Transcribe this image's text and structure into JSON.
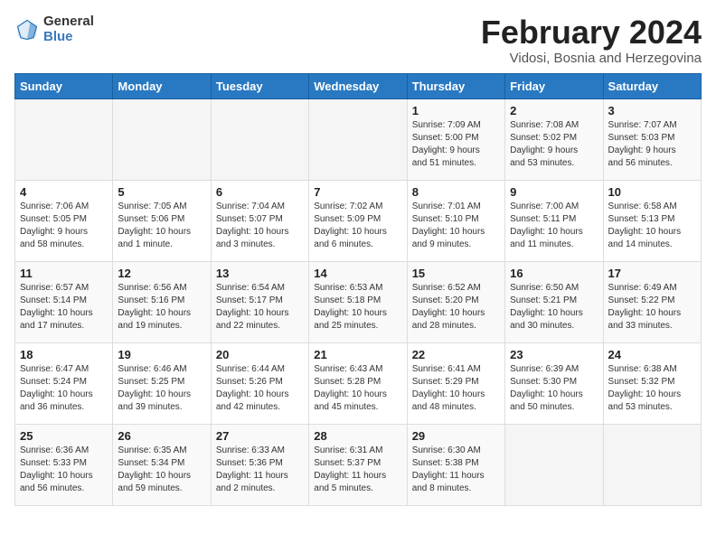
{
  "logo": {
    "general": "General",
    "blue": "Blue"
  },
  "title": "February 2024",
  "subtitle": "Vidosi, Bosnia and Herzegovina",
  "weekdays": [
    "Sunday",
    "Monday",
    "Tuesday",
    "Wednesday",
    "Thursday",
    "Friday",
    "Saturday"
  ],
  "weeks": [
    [
      {
        "day": "",
        "info": ""
      },
      {
        "day": "",
        "info": ""
      },
      {
        "day": "",
        "info": ""
      },
      {
        "day": "",
        "info": ""
      },
      {
        "day": "1",
        "info": "Sunrise: 7:09 AM\nSunset: 5:00 PM\nDaylight: 9 hours\nand 51 minutes."
      },
      {
        "day": "2",
        "info": "Sunrise: 7:08 AM\nSunset: 5:02 PM\nDaylight: 9 hours\nand 53 minutes."
      },
      {
        "day": "3",
        "info": "Sunrise: 7:07 AM\nSunset: 5:03 PM\nDaylight: 9 hours\nand 56 minutes."
      }
    ],
    [
      {
        "day": "4",
        "info": "Sunrise: 7:06 AM\nSunset: 5:05 PM\nDaylight: 9 hours\nand 58 minutes."
      },
      {
        "day": "5",
        "info": "Sunrise: 7:05 AM\nSunset: 5:06 PM\nDaylight: 10 hours\nand 1 minute."
      },
      {
        "day": "6",
        "info": "Sunrise: 7:04 AM\nSunset: 5:07 PM\nDaylight: 10 hours\nand 3 minutes."
      },
      {
        "day": "7",
        "info": "Sunrise: 7:02 AM\nSunset: 5:09 PM\nDaylight: 10 hours\nand 6 minutes."
      },
      {
        "day": "8",
        "info": "Sunrise: 7:01 AM\nSunset: 5:10 PM\nDaylight: 10 hours\nand 9 minutes."
      },
      {
        "day": "9",
        "info": "Sunrise: 7:00 AM\nSunset: 5:11 PM\nDaylight: 10 hours\nand 11 minutes."
      },
      {
        "day": "10",
        "info": "Sunrise: 6:58 AM\nSunset: 5:13 PM\nDaylight: 10 hours\nand 14 minutes."
      }
    ],
    [
      {
        "day": "11",
        "info": "Sunrise: 6:57 AM\nSunset: 5:14 PM\nDaylight: 10 hours\nand 17 minutes."
      },
      {
        "day": "12",
        "info": "Sunrise: 6:56 AM\nSunset: 5:16 PM\nDaylight: 10 hours\nand 19 minutes."
      },
      {
        "day": "13",
        "info": "Sunrise: 6:54 AM\nSunset: 5:17 PM\nDaylight: 10 hours\nand 22 minutes."
      },
      {
        "day": "14",
        "info": "Sunrise: 6:53 AM\nSunset: 5:18 PM\nDaylight: 10 hours\nand 25 minutes."
      },
      {
        "day": "15",
        "info": "Sunrise: 6:52 AM\nSunset: 5:20 PM\nDaylight: 10 hours\nand 28 minutes."
      },
      {
        "day": "16",
        "info": "Sunrise: 6:50 AM\nSunset: 5:21 PM\nDaylight: 10 hours\nand 30 minutes."
      },
      {
        "day": "17",
        "info": "Sunrise: 6:49 AM\nSunset: 5:22 PM\nDaylight: 10 hours\nand 33 minutes."
      }
    ],
    [
      {
        "day": "18",
        "info": "Sunrise: 6:47 AM\nSunset: 5:24 PM\nDaylight: 10 hours\nand 36 minutes."
      },
      {
        "day": "19",
        "info": "Sunrise: 6:46 AM\nSunset: 5:25 PM\nDaylight: 10 hours\nand 39 minutes."
      },
      {
        "day": "20",
        "info": "Sunrise: 6:44 AM\nSunset: 5:26 PM\nDaylight: 10 hours\nand 42 minutes."
      },
      {
        "day": "21",
        "info": "Sunrise: 6:43 AM\nSunset: 5:28 PM\nDaylight: 10 hours\nand 45 minutes."
      },
      {
        "day": "22",
        "info": "Sunrise: 6:41 AM\nSunset: 5:29 PM\nDaylight: 10 hours\nand 48 minutes."
      },
      {
        "day": "23",
        "info": "Sunrise: 6:39 AM\nSunset: 5:30 PM\nDaylight: 10 hours\nand 50 minutes."
      },
      {
        "day": "24",
        "info": "Sunrise: 6:38 AM\nSunset: 5:32 PM\nDaylight: 10 hours\nand 53 minutes."
      }
    ],
    [
      {
        "day": "25",
        "info": "Sunrise: 6:36 AM\nSunset: 5:33 PM\nDaylight: 10 hours\nand 56 minutes."
      },
      {
        "day": "26",
        "info": "Sunrise: 6:35 AM\nSunset: 5:34 PM\nDaylight: 10 hours\nand 59 minutes."
      },
      {
        "day": "27",
        "info": "Sunrise: 6:33 AM\nSunset: 5:36 PM\nDaylight: 11 hours\nand 2 minutes."
      },
      {
        "day": "28",
        "info": "Sunrise: 6:31 AM\nSunset: 5:37 PM\nDaylight: 11 hours\nand 5 minutes."
      },
      {
        "day": "29",
        "info": "Sunrise: 6:30 AM\nSunset: 5:38 PM\nDaylight: 11 hours\nand 8 minutes."
      },
      {
        "day": "",
        "info": ""
      },
      {
        "day": "",
        "info": ""
      }
    ]
  ]
}
